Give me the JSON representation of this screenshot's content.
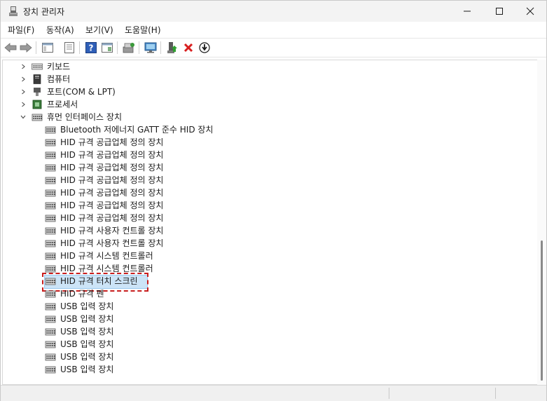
{
  "window": {
    "title": "장치 관리자"
  },
  "menu": {
    "items": [
      "파일(F)",
      "동작(A)",
      "보기(V)",
      "도움말(H)"
    ]
  },
  "toolbar": {
    "icons": [
      "back-arrow-icon",
      "forward-arrow-icon",
      "properties-icon",
      "driver-icon",
      "help-icon",
      "view-icon",
      "scan-hardware-icon",
      "monitor-icon",
      "add-driver-icon",
      "uninstall-icon",
      "update-driver-icon"
    ]
  },
  "tree": {
    "categories": [
      {
        "label": "키보드",
        "expanded": false
      },
      {
        "label": "컴퓨터",
        "expanded": false
      },
      {
        "label": "포트(COM & LPT)",
        "expanded": false
      },
      {
        "label": "프로세서",
        "expanded": false
      },
      {
        "label": "휴먼 인터페이스 장치",
        "expanded": true
      }
    ],
    "devices": [
      "Bluetooth 저에너지 GATT 준수 HID 장치",
      "HID 규격 공급업체 정의 장치",
      "HID 규격 공급업체 정의 장치",
      "HID 규격 공급업체 정의 장치",
      "HID 규격 공급업체 정의 장치",
      "HID 규격 공급업체 정의 장치",
      "HID 규격 공급업체 정의 장치",
      "HID 규격 공급업체 정의 장치",
      "HID 규격 사용자 컨트롤 장치",
      "HID 규격 사용자 컨트롤 장치",
      "HID 규격 시스템 컨트롤러",
      "HID 규격 시스템 컨트롤러",
      "HID 규격 터치 스크린",
      "HID 규격 펜",
      "USB 입력 장치",
      "USB 입력 장치",
      "USB 입력 장치",
      "USB 입력 장치",
      "USB 입력 장치",
      "USB 입력 장치"
    ],
    "selected_index": 12
  },
  "colors": {
    "selection": "#cce4f7",
    "focus_outline": "#c81e1e",
    "uninstall": "#d81e1e"
  }
}
